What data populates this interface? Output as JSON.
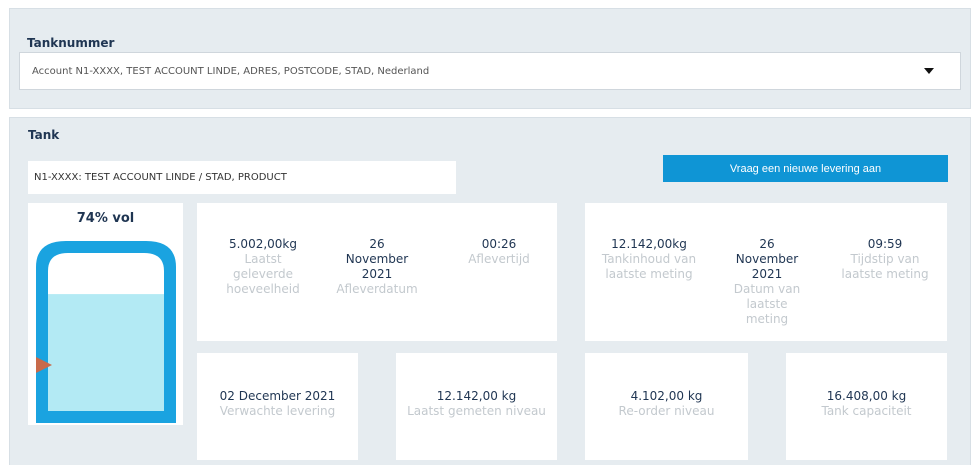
{
  "tank_selector": {
    "label": "Tanknummer",
    "selected": "Account N1-XXXX, TEST ACCOUNT LINDE, ADRES, POSTCODE, STAD, Nederland"
  },
  "tank": {
    "section_title": "Tank",
    "id_value": "N1-XXXX: TEST ACCOUNT LINDE / STAD, PRODUCT",
    "request_button": "Vraag een nieuwe levering aan",
    "fill_label": "74% vol",
    "fill_fraction": 0.74
  },
  "delivery_stats": [
    {
      "value": "5.002,00kg",
      "label": "Laatst geleverde hoeveelheid"
    },
    {
      "value": "26 November 2021",
      "label": "Afleverdatum"
    },
    {
      "value": "00:26",
      "label": "Aflevertijd"
    }
  ],
  "measurement_stats": [
    {
      "value": "12.142,00kg",
      "label": "Tankinhoud van laatste meting"
    },
    {
      "value": "26 November 2021",
      "label": "Datum van laatste meting"
    },
    {
      "value": "09:59",
      "label": "Tijdstip van laatste meting"
    }
  ],
  "summary_cards": [
    {
      "value": "02 December 2021",
      "label": "Verwachte levering"
    },
    {
      "value": "12.142,00 kg",
      "label": "Laatst gemeten niveau"
    },
    {
      "value": "4.102,00 kg",
      "label": "Re-order niveau"
    },
    {
      "value": "16.408,00 kg",
      "label": "Tank capaciteit"
    }
  ],
  "colors": {
    "accent": "#0f95d5",
    "tank_body": "#1aa3e0",
    "tank_fill": "#b3eaf4",
    "marker": "#c86a4a"
  }
}
